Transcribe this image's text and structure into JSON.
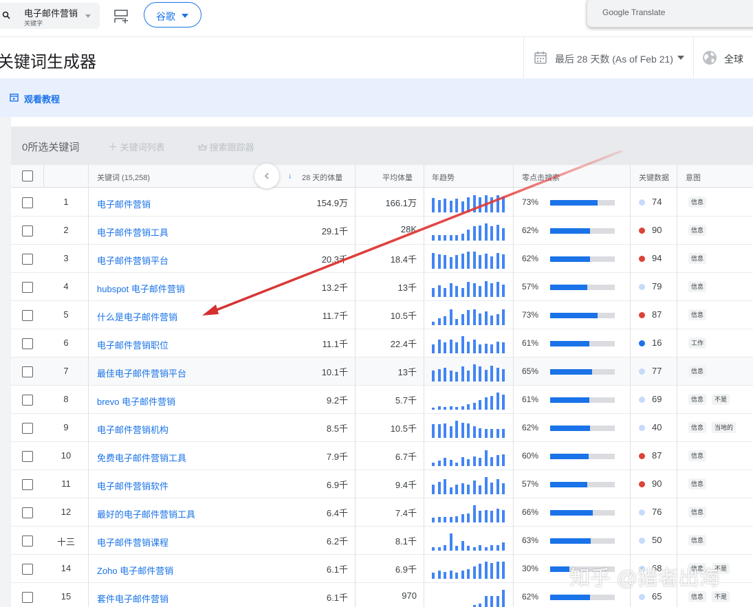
{
  "header": {
    "search": {
      "keyword": "电子邮件营销",
      "type": "关键字"
    },
    "engine": "谷歌",
    "translate_tab": "Google Translate"
  },
  "title_row": {
    "title": "关键词生成器",
    "date_range": "最后 28 天数 (As of Feb 21)",
    "region": "全球"
  },
  "tutorial": {
    "label": "观看教程"
  },
  "toolbar": {
    "selected": "0所选关键词",
    "keyword_list": "关键词列表",
    "search_tracker": "搜索跟踪器"
  },
  "table": {
    "headers": {
      "keyword": "关键词 (15,258)",
      "volume": "28 天的体量",
      "avg": "平均体量",
      "trend": "年趋势",
      "zero_click": "零点击搜索",
      "kd": "关键数据",
      "intent": "意图"
    },
    "rows": [
      {
        "idx": "1",
        "keyword": "电子邮件营销",
        "volume": "154.9万",
        "avg": "166.1万",
        "zc": "73%",
        "zc_val": 0.73,
        "kd": "74",
        "dot": "#c6dafc",
        "intents": [
          "信息"
        ],
        "trend": [
          0.8,
          0.7,
          0.75,
          0.65,
          0.75,
          0.6,
          0.85,
          0.95,
          0.85,
          0.95,
          0.85,
          0.95,
          0.9
        ]
      },
      {
        "idx": "2",
        "keyword": "电子邮件营销工具",
        "volume": "29.1千",
        "avg": "28K",
        "zc": "62%",
        "zc_val": 0.62,
        "kd": "90",
        "dot": "#db4437",
        "intents": [
          "信息"
        ],
        "trend": [
          0.3,
          0.3,
          0.3,
          0.3,
          0.3,
          0.4,
          0.6,
          0.8,
          0.85,
          0.95,
          0.8,
          0.9,
          0.7
        ]
      },
      {
        "idx": "3",
        "keyword": "电子邮件营销平台",
        "volume": "20.3千",
        "avg": "18.4千",
        "zc": "62%",
        "zc_val": 0.62,
        "kd": "94",
        "dot": "#db4437",
        "intents": [
          "信息"
        ],
        "trend": [
          0.9,
          0.8,
          0.75,
          0.65,
          0.75,
          0.85,
          0.95,
          0.95,
          0.75,
          0.85,
          0.7,
          0.9,
          0.8
        ]
      },
      {
        "idx": "4",
        "keyword": "hubspot 电子邮件营销",
        "volume": "13.2千",
        "avg": "13千",
        "zc": "57%",
        "zc_val": 0.57,
        "kd": "79",
        "dot": "#c6dafc",
        "intents": [
          "信息"
        ],
        "trend": [
          0.5,
          0.65,
          0.5,
          0.75,
          0.6,
          0.5,
          0.85,
          0.75,
          0.6,
          0.9,
          0.75,
          0.85,
          0.7
        ]
      },
      {
        "idx": "5",
        "keyword": "什么是电子邮件营销",
        "volume": "11.7千",
        "avg": "10.5千",
        "zc": "73%",
        "zc_val": 0.73,
        "kd": "87",
        "dot": "#db4437",
        "intents": [
          "信息"
        ],
        "trend": [
          0.2,
          0.4,
          0.5,
          0.9,
          0.35,
          0.6,
          0.85,
          0.9,
          0.65,
          0.75,
          0.55,
          0.6,
          0.9
        ]
      },
      {
        "idx": "6",
        "keyword": "电子邮件营销职位",
        "volume": "11.1千",
        "avg": "22.4千",
        "zc": "61%",
        "zc_val": 0.61,
        "kd": "16",
        "dot": "#1a73e8",
        "intents": [
          "工作"
        ],
        "trend": [
          0.5,
          0.75,
          0.6,
          0.75,
          0.6,
          0.95,
          0.65,
          0.75,
          0.5,
          0.55,
          0.5,
          0.65,
          0.6
        ]
      },
      {
        "idx": "7",
        "keyword": "最佳电子邮件营销平台",
        "volume": "10.1千",
        "avg": "13千",
        "zc": "65%",
        "zc_val": 0.65,
        "kd": "77",
        "dot": "#c6dafc",
        "intents": [
          "信息"
        ],
        "trend": [
          0.6,
          0.7,
          0.75,
          0.6,
          0.55,
          0.85,
          0.6,
          0.95,
          0.85,
          0.65,
          0.9,
          0.75,
          0.7
        ]
      },
      {
        "idx": "8",
        "keyword": "brevo 电子邮件营销",
        "volume": "9.2千",
        "avg": "5.7千",
        "zc": "61%",
        "zc_val": 0.61,
        "kd": "69",
        "dot": "#c6dafc",
        "intents": [
          "信息",
          "不是"
        ],
        "trend": [
          0.1,
          0.2,
          0.15,
          0.2,
          0.15,
          0.2,
          0.3,
          0.4,
          0.55,
          0.7,
          0.75,
          0.95,
          0.85
        ]
      },
      {
        "idx": "9",
        "keyword": "电子邮件营销机构",
        "volume": "8.5千",
        "avg": "10.5千",
        "zc": "62%",
        "zc_val": 0.62,
        "kd": "40",
        "dot": "#c6dafc",
        "intents": [
          "信息",
          "当地的"
        ],
        "trend": [
          0.75,
          0.75,
          0.8,
          0.65,
          0.95,
          0.85,
          0.8,
          0.65,
          0.55,
          0.5,
          0.5,
          0.5,
          0.5
        ]
      },
      {
        "idx": "10",
        "keyword": "免费电子邮件营销工具",
        "volume": "7.9千",
        "avg": "6.7千",
        "zc": "60%",
        "zc_val": 0.6,
        "kd": "87",
        "dot": "#db4437",
        "intents": [
          "信息"
        ],
        "trend": [
          0.2,
          0.3,
          0.45,
          0.35,
          0.2,
          0.5,
          0.4,
          0.55,
          0.45,
          0.9,
          0.5,
          0.6,
          0.65
        ]
      },
      {
        "idx": "11",
        "keyword": "电子邮件营销软件",
        "volume": "6.9千",
        "avg": "9.4千",
        "zc": "57%",
        "zc_val": 0.57,
        "kd": "90",
        "dot": "#db4437",
        "intents": [
          "信息"
        ],
        "trend": [
          0.55,
          0.7,
          0.85,
          0.4,
          0.55,
          0.6,
          0.55,
          0.75,
          0.5,
          0.95,
          0.65,
          0.85,
          0.6
        ]
      },
      {
        "idx": "12",
        "keyword": "最好的电子邮件营销工具",
        "volume": "6.4千",
        "avg": "7.4千",
        "zc": "66%",
        "zc_val": 0.66,
        "kd": "76",
        "dot": "#c6dafc",
        "intents": [
          "信息"
        ],
        "trend": [
          0.25,
          0.3,
          0.3,
          0.3,
          0.35,
          0.45,
          0.5,
          0.95,
          0.65,
          0.7,
          0.65,
          0.75,
          0.7
        ]
      },
      {
        "idx": "十三",
        "keyword": "电子邮件营销课程",
        "volume": "6.2千",
        "avg": "8.1千",
        "zc": "63%",
        "zc_val": 0.63,
        "kd": "50",
        "dot": "#c6dafc",
        "intents": [
          "信息"
        ],
        "trend": [
          0.2,
          0.2,
          0.3,
          0.95,
          0.25,
          0.55,
          0.25,
          0.2,
          0.3,
          0.2,
          0.3,
          0.3,
          0.45
        ]
      },
      {
        "idx": "14",
        "keyword": "Zoho 电子邮件营销",
        "volume": "6.1千",
        "avg": "6.9千",
        "zc": "30%",
        "zc_val": 0.3,
        "kd": "68",
        "dot": "#c6dafc",
        "intents": [
          "信息",
          "不是"
        ],
        "trend": [
          0.35,
          0.45,
          0.4,
          0.45,
          0.35,
          0.45,
          0.55,
          0.7,
          0.85,
          0.95,
          0.9,
          0.95,
          0.95
        ]
      },
      {
        "idx": "15",
        "keyword": "套件电子邮件营销",
        "volume": "6.1千",
        "avg": "970",
        "zc": "62%",
        "zc_val": 0.62,
        "kd": "65",
        "dot": "#c6dafc",
        "intents": [
          "信息",
          "不是"
        ],
        "trend": [
          0,
          0,
          0,
          0,
          0,
          0,
          0,
          0.1,
          0.2,
          0.6,
          0.6,
          0.6,
          0.95
        ]
      }
    ]
  },
  "watermark": "知乎 @猎者出海"
}
